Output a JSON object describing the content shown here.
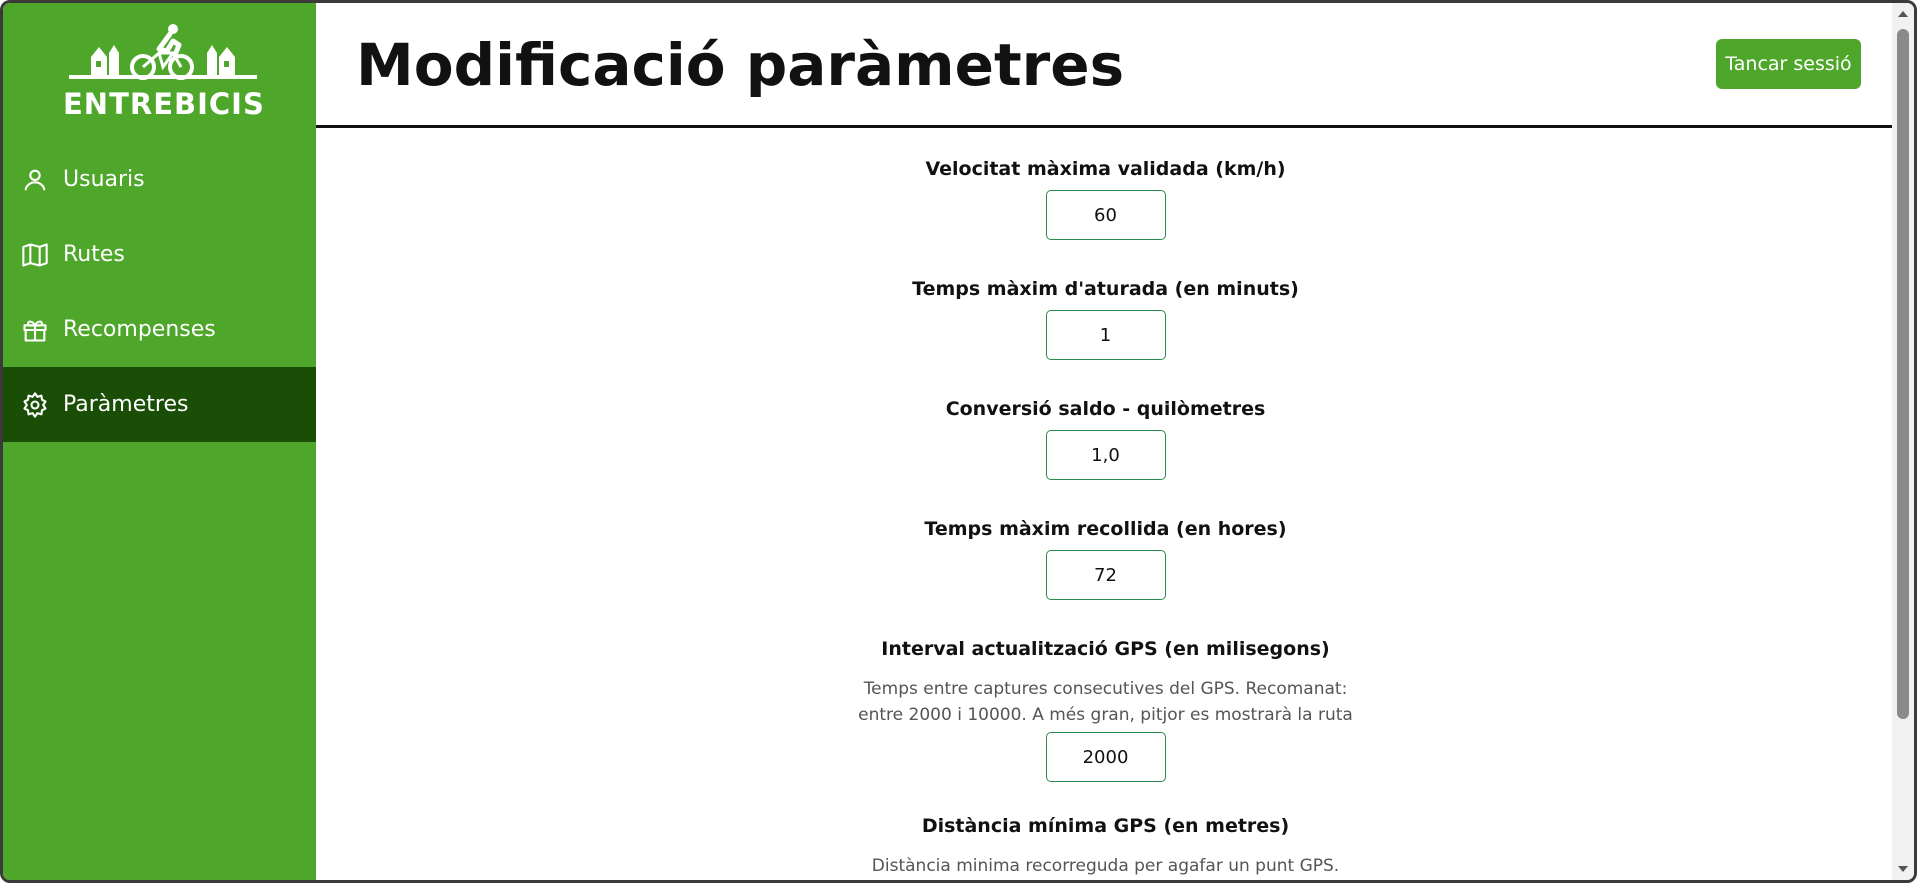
{
  "brand": {
    "name": "ENTREBICIS"
  },
  "sidebar": {
    "items": [
      {
        "label": "Usuaris",
        "icon": "user-icon",
        "active": false
      },
      {
        "label": "Rutes",
        "icon": "map-icon",
        "active": false
      },
      {
        "label": "Recompenses",
        "icon": "gift-icon",
        "active": false
      },
      {
        "label": "Paràmetres",
        "icon": "gear-icon",
        "active": true
      }
    ]
  },
  "header": {
    "title": "Modificació paràmetres",
    "logout_label": "Tancar sessió"
  },
  "fields": [
    {
      "label": "Velocitat màxima validada (km/h)",
      "value": "60"
    },
    {
      "label": "Temps màxim d'aturada (en minuts)",
      "value": "1"
    },
    {
      "label": "Conversió saldo - quilòmetres",
      "value": "1,0"
    },
    {
      "label": "Temps màxim recollida (en hores)",
      "value": "72"
    },
    {
      "label": "Interval actualització GPS (en milisegons)",
      "description": "Temps entre captures consecutives del GPS. Recomanat: entre 2000 i 10000. A més gran, pitjor es mostrarà la ruta",
      "value": "2000"
    },
    {
      "label": "Distància mínima GPS (en metres)",
      "description": "Distància minima recorreguda per agafar un punt GPS."
    }
  ],
  "colors": {
    "brand_green": "#4ea72b",
    "active_green": "#1a4d05",
    "input_border": "#2d8a4e"
  }
}
